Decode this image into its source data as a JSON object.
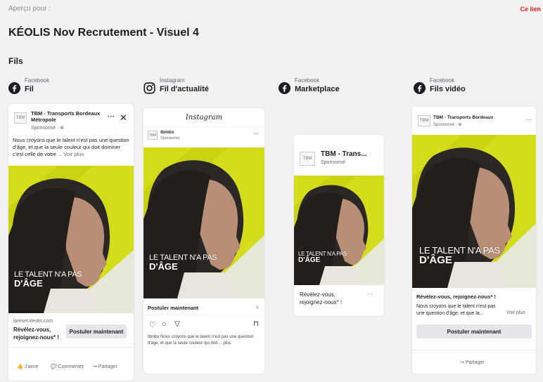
{
  "header": {
    "preview_label": "Aperçu pour :",
    "title": "KÉOLIS Nov Recrutement - Visuel 4",
    "link": "Ce lien",
    "section": "Fils"
  },
  "placements": [
    {
      "platform": "Facebook",
      "placement": "Fil"
    },
    {
      "platform": "Instagram",
      "placement": "Fil d'actualité"
    },
    {
      "platform": "Facebook",
      "placement": "Marketplace"
    },
    {
      "platform": "Facebook",
      "placement": "Fils vidéo"
    }
  ],
  "ad_creative": {
    "line1": "LE TALENT N'A PAS",
    "line2": "D'ÂGE",
    "avatar": "TBM"
  },
  "fb_feed": {
    "page_name": "TBM - Transports Bordeaux Métropole",
    "sponsored": "Sponsorisé · ⊕",
    "body": "Nous croyons que le talent n'est pas une question d'âge, et que la seule couleur qui doit dominer c'est celle de votre",
    "see_more": "... Voir plus",
    "domain": "lareset.keolis.com",
    "headline": "Révélez-vous, rejoignez-nous* !",
    "cta": "Postuler maintenant",
    "actions": [
      "J'aime",
      "Commenter",
      "Partager"
    ]
  },
  "ig_feed": {
    "app_name": "Instagram",
    "account": "tbmbx",
    "account_sub": "Sponsorisé",
    "cta": "Postuler maintenant",
    "caption": "tbmbx Nous croyons que le talent n'est pas une question d'âge, et que la seule couleur qui doit ... plus"
  },
  "marketplace": {
    "page_name": "TBM - Trans...",
    "sponsored": "Sponsorisé",
    "headline": "Révélez-vous, rejoignez-nous* !"
  },
  "video_feed": {
    "page_name": "TBM · Transports Bordeaux",
    "sponsored": "Sponsorisé · ⊕",
    "headline": "Révélez-vous, rejoignez-nous* !",
    "body": "Nous croyons que le talent n'est pas une question d'âge, et que la...",
    "see_more": "Voir plus",
    "cta": "Postuler maintenant",
    "share": "Partager"
  }
}
